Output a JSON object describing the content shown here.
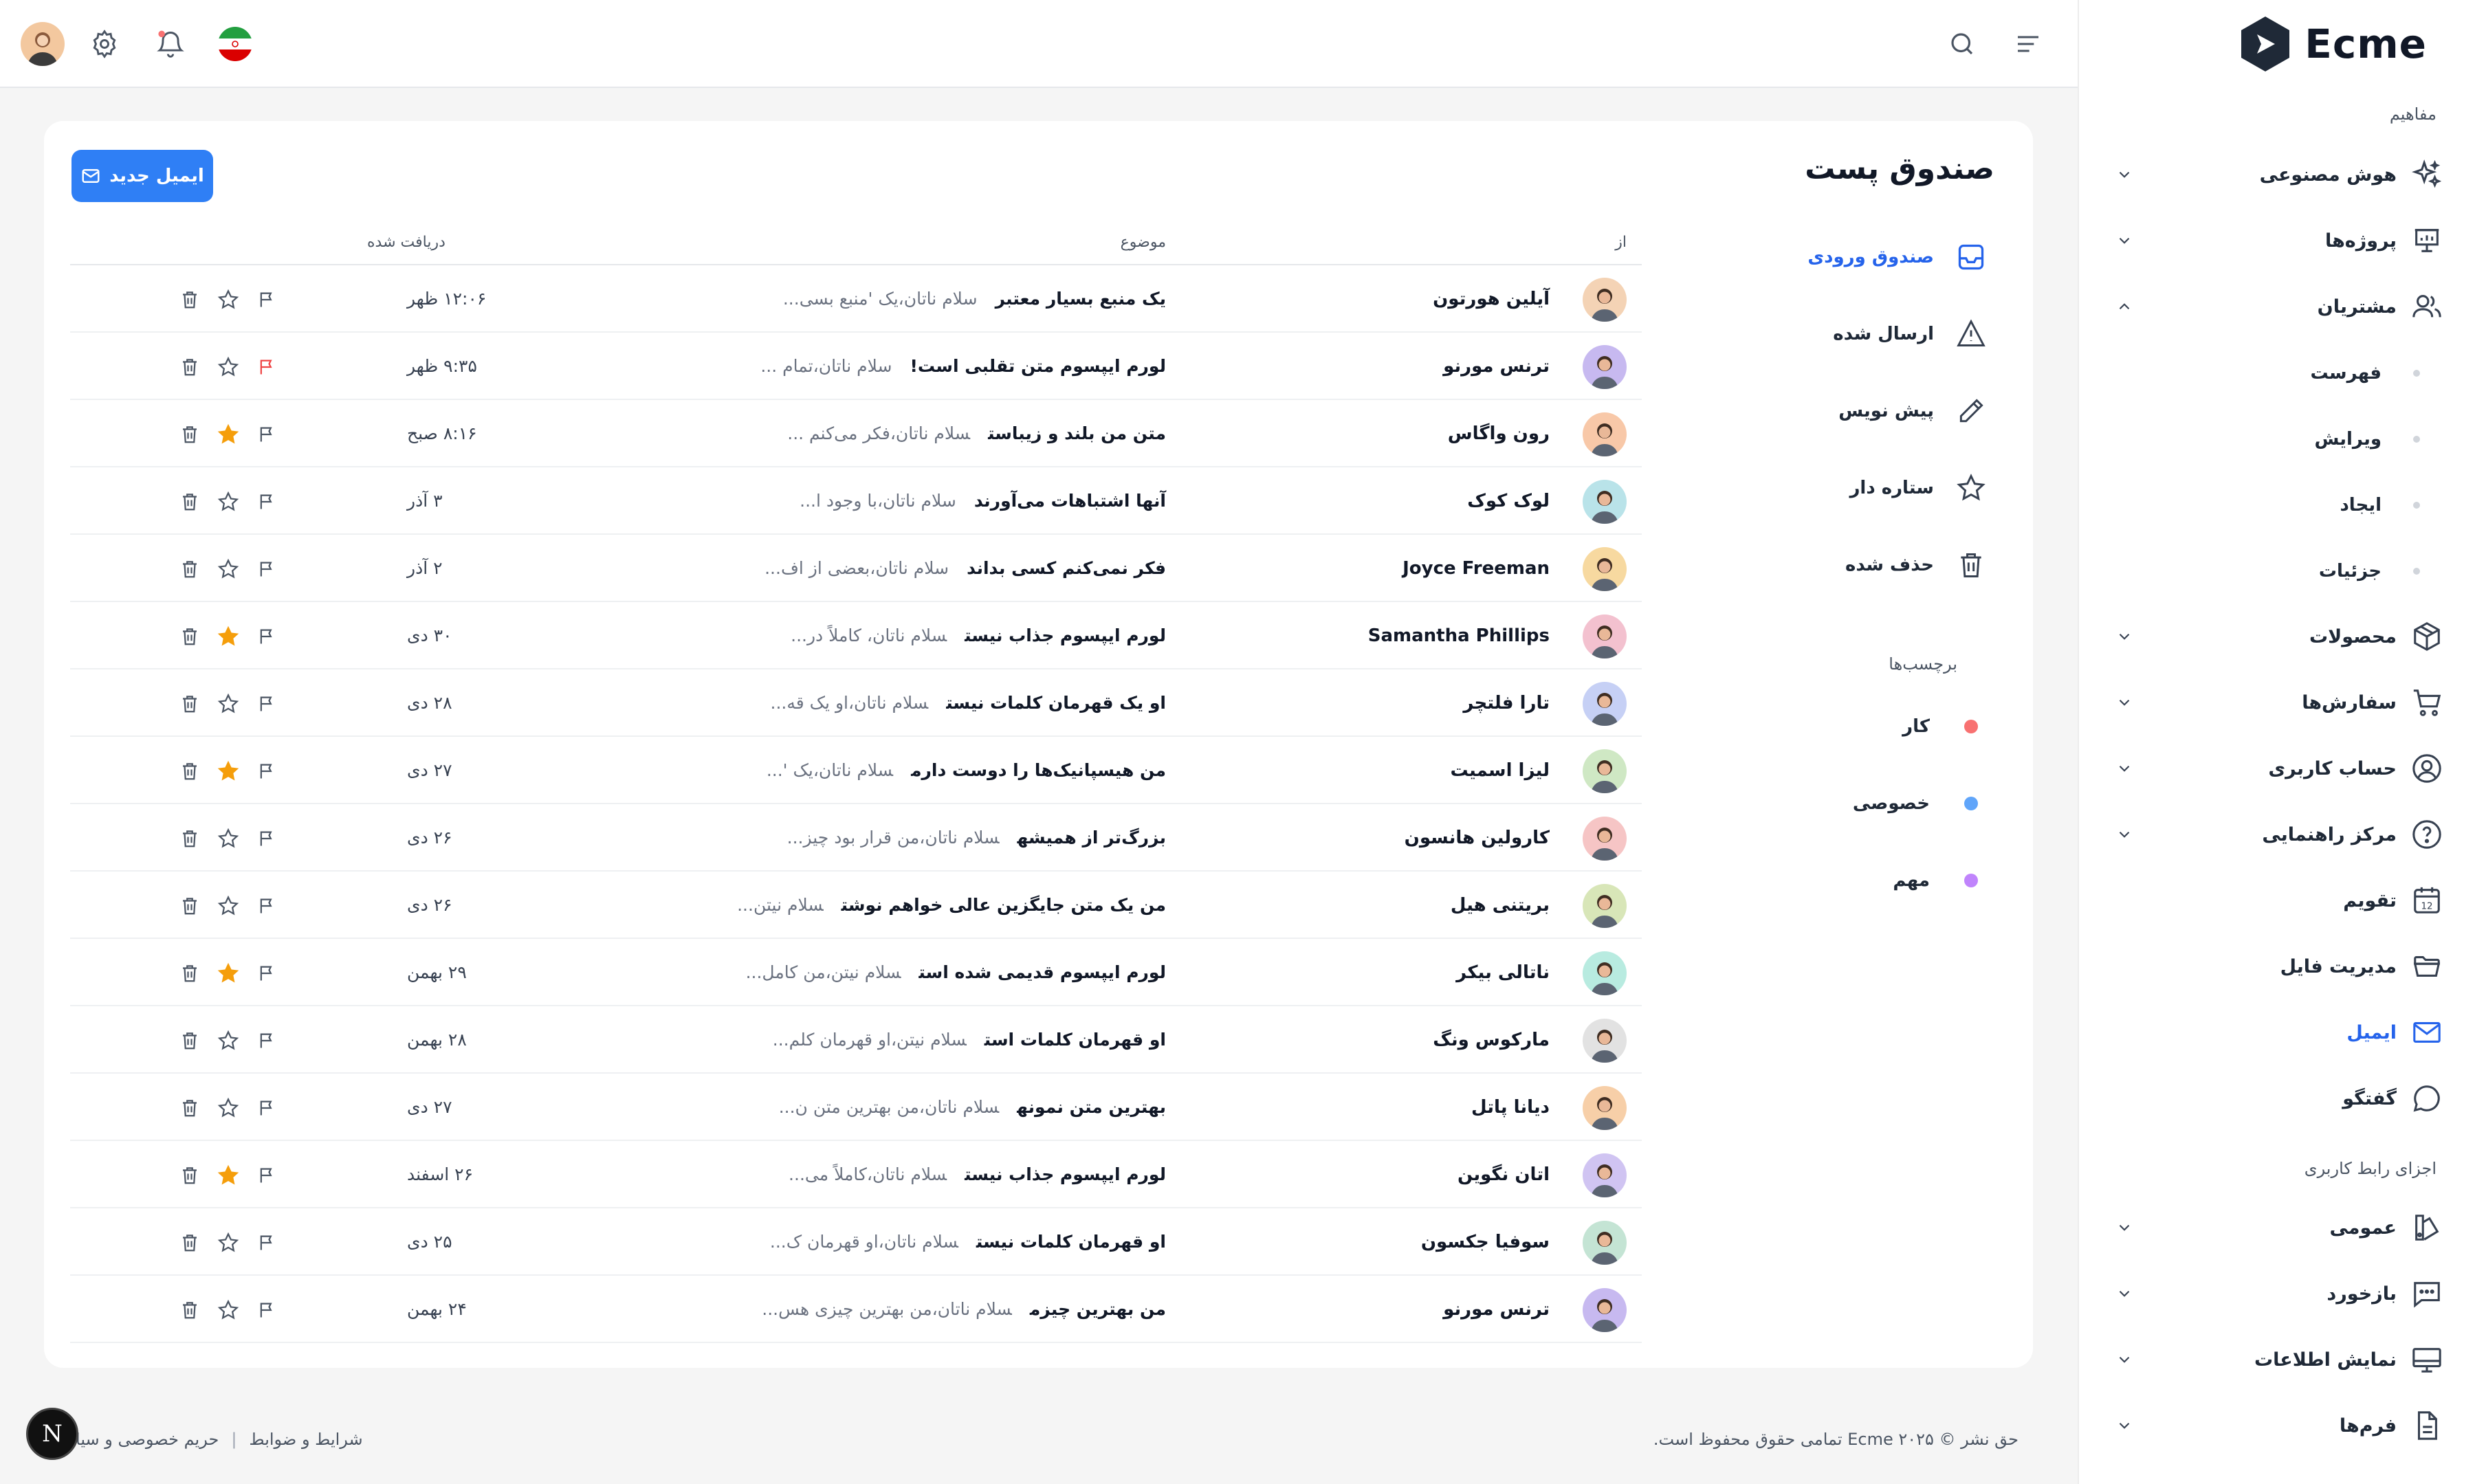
{
  "brand": {
    "name": "Ecme",
    "accent": "#2563eb",
    "button_color": "#2f7ff5"
  },
  "sidebar": {
    "group_concepts": "مفاهیم",
    "items": [
      {
        "label": "هوش مصنوعی",
        "icon": "sparkle-icon",
        "chevron": "down"
      },
      {
        "label": "پروژه‌ها",
        "icon": "presentation-icon",
        "chevron": "down"
      },
      {
        "label": "مشتریان",
        "icon": "users-icon",
        "chevron": "up"
      }
    ],
    "sub_items": [
      "فهرست",
      "ویرایش",
      "ایجاد",
      "جزئیات"
    ],
    "items2": [
      {
        "label": "محصولات",
        "icon": "box-icon",
        "chevron": "down"
      },
      {
        "label": "سفارش‌ها",
        "icon": "cart-icon",
        "chevron": "down"
      },
      {
        "label": "حساب کاربری",
        "icon": "user-circle-icon",
        "chevron": "down"
      },
      {
        "label": "مرکز راهنمایی",
        "icon": "help-icon",
        "chevron": "down"
      },
      {
        "label": "تقویم",
        "icon": "calendar-icon",
        "calendar_day": "12"
      },
      {
        "label": "مدیریت فایل",
        "icon": "folder-icon"
      },
      {
        "label": "ایمیل",
        "icon": "mail-icon",
        "active": true
      },
      {
        "label": "گفتگو",
        "icon": "chat-icon"
      }
    ],
    "group_ui": "اجزای رابط کاربری",
    "items3": [
      {
        "label": "عمومی",
        "icon": "swatch-icon",
        "chevron": "down"
      },
      {
        "label": "بازخورد",
        "icon": "message-dots-icon",
        "chevron": "down"
      },
      {
        "label": "نمایش اطلاعات",
        "icon": "monitor-icon",
        "chevron": "down"
      },
      {
        "label": "فرم‌ها",
        "icon": "document-icon",
        "chevron": "down"
      }
    ]
  },
  "header": {
    "icons": [
      "menu-icon",
      "search-icon",
      "flag-iran-icon",
      "bell-icon",
      "gear-icon",
      "user-avatar"
    ],
    "notification_dot_color": "#f87171"
  },
  "mail": {
    "title": "صندوق پست",
    "new_button": "ایمیل جدید",
    "folders": [
      {
        "label": "صندوق ورودی",
        "icon": "inbox-icon",
        "active": true
      },
      {
        "label": "ارسال شده",
        "icon": "send-icon"
      },
      {
        "label": "پیش نویس",
        "icon": "pencil-icon"
      },
      {
        "label": "ستاره دار",
        "icon": "star-icon"
      },
      {
        "label": "حذف شده",
        "icon": "trash-icon"
      }
    ],
    "labels_title": "برچسب‌ها",
    "labels": [
      {
        "label": "کار",
        "color": "#f87171"
      },
      {
        "label": "خصوصی",
        "color": "#60a5fa"
      },
      {
        "label": "مهم",
        "color": "#c084fc"
      }
    ],
    "columns": {
      "from": "از",
      "subject": "موضوع",
      "received": "دریافت شده"
    },
    "rows": [
      {
        "from": "آیلین هورتون",
        "subject": "یک منبع بسیار معتبر",
        "preview": "سلام ناتان،یک 'منبع بسی...",
        "date": "۱۲:۰۶ ظهر",
        "starred": false,
        "flagged": false,
        "avatar_color": "#f4d3b5"
      },
      {
        "from": "ترنس مورنو",
        "subject": "لورم ایپسوم متن تقلبی است!",
        "preview": "سلام ناتان،تمام ...",
        "date": "۹:۳۵ ظهر",
        "starred": false,
        "flagged": true,
        "avatar_color": "#c7b9f0"
      },
      {
        "from": "رون واگاس",
        "subject": "متن من بلند و زیباست",
        "preview": "سلام ناتان،فکر می‌کنم ...",
        "date": "۸:۱۶ صبح",
        "starred": true,
        "flagged": false,
        "avatar_color": "#f8c8a8"
      },
      {
        "from": "لوک کوک",
        "subject": "آنها اشتباهات می‌آورند",
        "preview": "سلام ناتان،با وجود ا...",
        "date": "۳ آذر",
        "starred": false,
        "flagged": false,
        "avatar_color": "#b9e3e9"
      },
      {
        "from": "Joyce Freeman",
        "subject": "فکر نمی‌کنم کسی بداند",
        "preview": "سلام ناتان،بعضی از اف...",
        "date": "۲ آذر",
        "starred": false,
        "flagged": false,
        "avatar_color": "#f7d9a0"
      },
      {
        "from": "Samantha Phillips",
        "subject": "لورم ایپسوم جذاب نیست",
        "preview": "سلام ناتان، کاملاً در...",
        "date": "۳۰ دی",
        "starred": true,
        "flagged": false,
        "avatar_color": "#f3c1cf"
      },
      {
        "from": "تارا فلتچر",
        "subject": "او یک قهرمان کلمات نیست",
        "preview": "سلام ناتان،او یک قه...",
        "date": "۲۸ دی",
        "starred": false,
        "flagged": false,
        "avatar_color": "#c6d0f5"
      },
      {
        "from": "لیزا اسمیت",
        "subject": "من هیسپانیک‌ها را دوست دارم",
        "preview": "سلام ناتان،یک '...",
        "date": "۲۷ دی",
        "starred": true,
        "flagged": false,
        "avatar_color": "#cfe8c4"
      },
      {
        "from": "کارولین هانسون",
        "subject": "بزرگ‌تر از همیشه",
        "preview": "سلام ناتان،من قرار بود چیز...",
        "date": "۲۶ دی",
        "starred": false,
        "flagged": false,
        "avatar_color": "#f6c5c5"
      },
      {
        "from": "بریتنی هیل",
        "subject": "من یک متن جایگزین عالی خواهم نوشت",
        "preview": "سلام نیتن...",
        "date": "۲۶ دی",
        "starred": false,
        "flagged": false,
        "avatar_color": "#d8e6b8"
      },
      {
        "from": "ناتالی بیکر",
        "subject": "لورم ایپسوم قدیمی شده است",
        "preview": "سلام نیتن،من کامل...",
        "date": "۲۹ بهمن",
        "starred": true,
        "flagged": false,
        "avatar_color": "#b8ebe0"
      },
      {
        "from": "مارکوس ونگ",
        "subject": "او قهرمان کلمات است",
        "preview": "سلام نیتن،او قهرمان کلم...",
        "date": "۲۸ بهمن",
        "starred": false,
        "flagged": false,
        "avatar_color": "#e2e2e2"
      },
      {
        "from": "دیانا پاتل",
        "subject": "بهترین متن نمونه",
        "preview": "سلام ناتان،من بهترین متن ن...",
        "date": "۲۷ دی",
        "starred": false,
        "flagged": false,
        "avatar_color": "#f7cfa8"
      },
      {
        "from": "اتان نگوین",
        "subject": "لورم ایپسوم جذاب نیست",
        "preview": "سلام ناتان،کاملاً می...",
        "date": "۲۶ اسفند",
        "starred": true,
        "flagged": false,
        "avatar_color": "#d0c4f2"
      },
      {
        "from": "سوفیا جکسون",
        "subject": "او قهرمان کلمات نیست",
        "preview": "سلام ناتان،او قهرمان ک...",
        "date": "۲۵ دی",
        "starred": false,
        "flagged": false,
        "avatar_color": "#c4e4d4"
      },
      {
        "from": "ترنس مورنو",
        "subject": "من بهترین چیزم",
        "preview": "سلام ناتان،من بهترین چیزی هس...",
        "date": "۲۴ بهمن",
        "starred": false,
        "flagged": false,
        "avatar_color": "#c7b9f0"
      }
    ]
  },
  "footer": {
    "copyright": "حق نشر © ۲۰۲۵ Ecme تمامی حقوق محفوظ است.",
    "terms": "شرایط و ضوابط",
    "separator": "|",
    "privacy": "حریم خصوصی و سیا",
    "fab_letter": "N"
  }
}
